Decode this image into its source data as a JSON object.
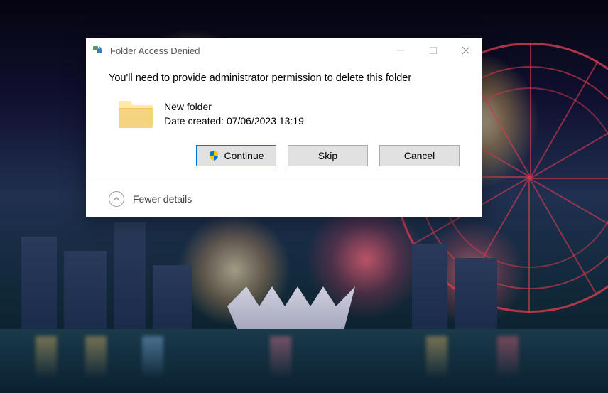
{
  "dialog": {
    "title": "Folder Access Denied",
    "message": "You'll need to provide administrator permission to delete this folder",
    "item": {
      "name": "New folder",
      "date_created_label": "Date created: 07/06/2023 13:19"
    },
    "buttons": {
      "continue": "Continue",
      "skip": "Skip",
      "cancel": "Cancel"
    },
    "footer": {
      "fewer_details": "Fewer details"
    }
  }
}
